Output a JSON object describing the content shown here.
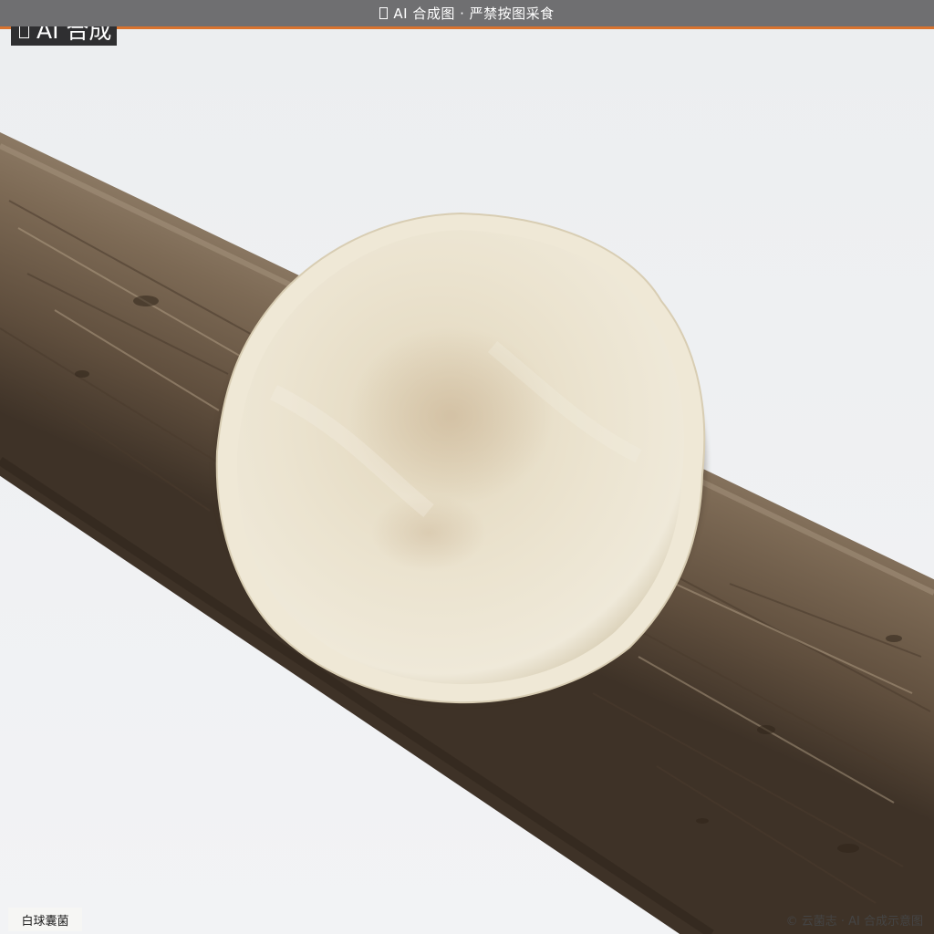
{
  "banner": {
    "icon": "image-icon",
    "text": "AI 合成图 · 严禁按图采食",
    "background": "#6f6f71",
    "accent": "#d9732e"
  },
  "badge": {
    "icon": "image-icon",
    "text": "AI 合成"
  },
  "caption": {
    "species": "白球囊菌"
  },
  "footer": {
    "copyright": "© 云菌志 · AI 合成示意图"
  },
  "photo": {
    "subject": "mushroom-cup",
    "substrate": "wooden-branch",
    "colors": {
      "background": "#eef0f2",
      "cap": "#e9e2cf",
      "wood": "#7a6650"
    }
  }
}
